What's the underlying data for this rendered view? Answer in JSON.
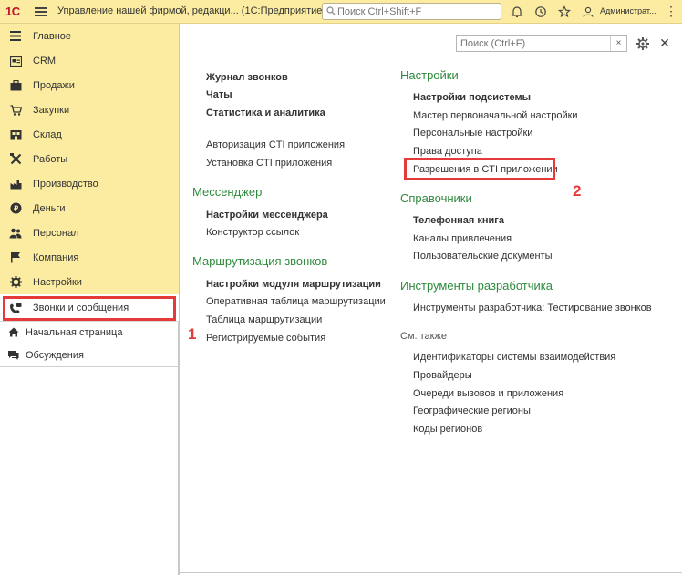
{
  "topbar": {
    "logo": "1С",
    "title": "Управление нашей фирмой, редакци... (1С:Предприятие)",
    "search_placeholder": "Поиск Ctrl+Shift+F",
    "user": "Администрат..."
  },
  "sidebar": {
    "items": [
      {
        "label": "Главное",
        "icon": "menu-lines-icon"
      },
      {
        "label": "CRM",
        "icon": "crm-card-icon"
      },
      {
        "label": "Продажи",
        "icon": "briefcase-icon"
      },
      {
        "label": "Закупки",
        "icon": "cart-icon"
      },
      {
        "label": "Склад",
        "icon": "warehouse-icon"
      },
      {
        "label": "Работы",
        "icon": "tools-icon"
      },
      {
        "label": "Производство",
        "icon": "factory-icon"
      },
      {
        "label": "Деньги",
        "icon": "coin-icon"
      },
      {
        "label": "Персонал",
        "icon": "people-icon"
      },
      {
        "label": "Компания",
        "icon": "flag-icon"
      },
      {
        "label": "Настройки",
        "icon": "gear-icon"
      },
      {
        "label": "Звонки и сообщения",
        "icon": "phone-icon"
      }
    ],
    "home_label": "Начальная страница",
    "discussions_label": "Обсуждения"
  },
  "panel": {
    "search_placeholder": "Поиск (Ctrl+F)",
    "clear_label": "×",
    "left": {
      "top_links": [
        "Журнал звонков",
        "Чаты",
        "Статистика и аналитика"
      ],
      "cti_links": [
        "Авторизация CTI приложения",
        "Установка CTI приложения"
      ],
      "messenger_title": "Мессенджер",
      "messenger_links": [
        "Настройки мессенджера",
        "Конструктор ссылок"
      ],
      "routing_title": "Маршрутизация звонков",
      "routing_links": [
        "Настройки модуля маршрутизации",
        "Оперативная таблица маршрутизации",
        "Таблица маршрутизации",
        "Регистрируемые события"
      ]
    },
    "right": {
      "settings_title": "Настройки",
      "settings_links": [
        "Настройки подсистемы",
        "Мастер первоначальной настройки",
        "Персональные настройки",
        "Права доступа",
        "Разрешения в CTI приложении"
      ],
      "refs_title": "Справочники",
      "refs_links": [
        "Телефонная книга",
        "Каналы привлечения",
        "Пользовательские документы"
      ],
      "dev_title": "Инструменты разработчика",
      "dev_links": [
        "Инструменты разработчика: Тестирование звонков"
      ],
      "see_also_title": "См. также",
      "see_also_links": [
        "Идентификаторы системы взаимодействия",
        "Провайдеры",
        "Очереди вызовов и приложения",
        "Географические регионы",
        "Коды регионов"
      ]
    }
  },
  "annotations": {
    "one": "1",
    "two": "2",
    "color": "#e53a3a"
  }
}
